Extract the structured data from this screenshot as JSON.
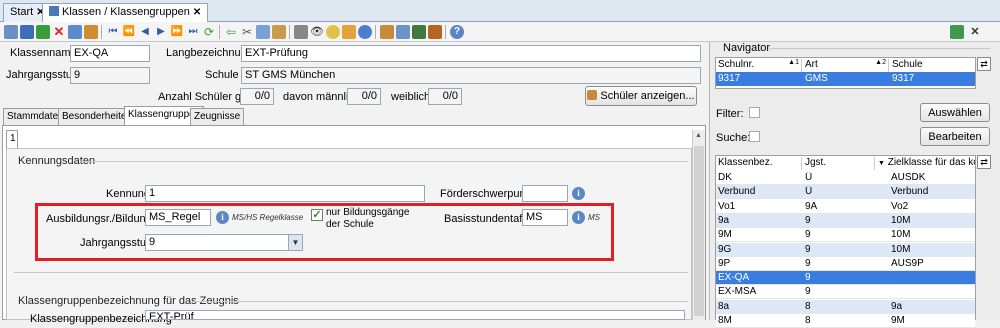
{
  "tabs": [
    {
      "label": "Start",
      "active": false
    },
    {
      "label": "Klassen / Klassengruppen",
      "active": true
    }
  ],
  "header": {
    "klassenname_label": "Klassenname",
    "klassenname_value": "EX-QA",
    "langbez_label": "Langbezeichnung",
    "langbez_value": "EXT-Prüfung",
    "jahrgangsstufe_label": "Jahrgangsstufe",
    "jahrgangsstufe_value": "9",
    "schule_label": "Schule",
    "schule_value": "ST GMS München",
    "anzahl_label": "Anzahl Schüler ges.",
    "anzahl_value": "0/0",
    "maennlich_label": "davon männlich",
    "maennlich_value": "0/0",
    "weiblich_label": "weiblich",
    "weiblich_value": "0/0",
    "schueler_button": "Schüler anzeigen..."
  },
  "form_tabs": [
    "Stammdaten",
    "Besonderheiten",
    "Klassengruppen",
    "Zeugnisse"
  ],
  "subtab": "1",
  "kennungsdaten": {
    "title": "Kennungsdaten",
    "kennung_label": "Kennung",
    "kennung_value": "1",
    "foerder_label": "Förderschwerpunkt",
    "foerder_value": "",
    "ausbildung_label": "Ausbildungsr./Bildungsg.",
    "ausbildung_value": "MS_Regel",
    "ausbildung_hint": "MS/HS Regelklasse",
    "nur_bildung_label_1": "nur Bildungsgänge",
    "nur_bildung_label_2": "der Schule",
    "nur_bildung_checked": true,
    "basisstunden_label": "Basisstundentafel",
    "basisstunden_value": "MS",
    "basisstunden_hint": "MS",
    "jgs_label": "Jahrgangsstufe",
    "jgs_value": "9"
  },
  "zeugnis_group": {
    "title": "Klassengruppenbezeichnung für das Zeugnis",
    "label": "Klassengruppenbezeichnung",
    "value": "EXT-Prüf"
  },
  "navigator": {
    "title": "Navigator",
    "columns": [
      "Schulnr.",
      "Art",
      "Schule"
    ],
    "row": [
      "9317",
      "GMS",
      "9317"
    ],
    "filter_label": "Filter:",
    "suche_label": "Suche:",
    "auswaehlen_button": "Auswählen",
    "bearbeiten_button": "Bearbeiten"
  },
  "class_grid": {
    "columns": [
      "Klassenbez.",
      "Jgst.",
      "Zielklasse für das ko..."
    ],
    "rows": [
      [
        "DK",
        "Ü",
        "AUSDK"
      ],
      [
        "Verbund",
        "Ü",
        "Verbund"
      ],
      [
        "Vo1",
        "9A",
        "Vo2"
      ],
      [
        "9a",
        "9",
        "10M"
      ],
      [
        "9M",
        "9",
        "10M"
      ],
      [
        "9G",
        "9",
        "10M"
      ],
      [
        "9P",
        "9",
        "AUS9P"
      ],
      [
        "EX-QA",
        "9",
        ""
      ],
      [
        "EX-MSA",
        "9",
        ""
      ],
      [
        "8a",
        "8",
        "9a"
      ],
      [
        "8M",
        "8",
        "9M"
      ]
    ],
    "selected_index": 7
  },
  "colors": {
    "highlight_red": "#e01e25",
    "selection_blue": "#3a7de0",
    "row_alt_blue": "#dde8f7"
  }
}
